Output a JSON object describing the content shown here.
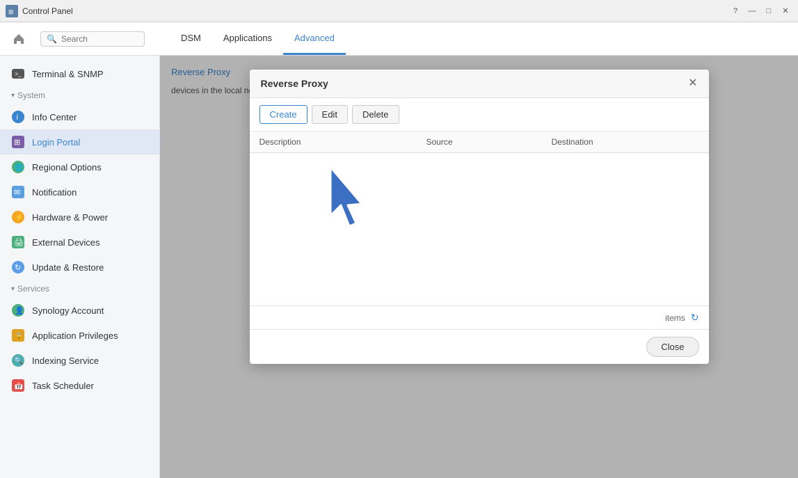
{
  "titlebar": {
    "title": "Control Panel",
    "help_label": "?",
    "minimize_label": "—",
    "maximize_label": "□",
    "close_label": "✕"
  },
  "topnav": {
    "search_placeholder": "Search",
    "tabs": [
      {
        "id": "dsm",
        "label": "DSM",
        "active": false
      },
      {
        "id": "applications",
        "label": "Applications",
        "active": false
      },
      {
        "id": "advanced",
        "label": "Advanced",
        "active": true
      }
    ]
  },
  "sidebar": {
    "terminal_item": {
      "label": "Terminal & SNMP"
    },
    "system_section": "System",
    "items": [
      {
        "id": "info-center",
        "label": "Info Center",
        "active": false
      },
      {
        "id": "login-portal",
        "label": "Login Portal",
        "active": true
      },
      {
        "id": "regional-options",
        "label": "Regional Options",
        "active": false
      },
      {
        "id": "notification",
        "label": "Notification",
        "active": false
      },
      {
        "id": "hardware-power",
        "label": "Hardware & Power",
        "active": false
      },
      {
        "id": "external-devices",
        "label": "External Devices",
        "active": false
      },
      {
        "id": "update-restore",
        "label": "Update & Restore",
        "active": false
      }
    ],
    "services_section": "Services",
    "service_items": [
      {
        "id": "synology-account",
        "label": "Synology Account",
        "active": false
      },
      {
        "id": "application-privileges",
        "label": "Application Privileges",
        "active": false
      },
      {
        "id": "indexing-service",
        "label": "Indexing Service",
        "active": false
      },
      {
        "id": "task-scheduler",
        "label": "Task Scheduler",
        "active": false
      }
    ]
  },
  "content": {
    "description": "devices in the local network."
  },
  "modal": {
    "title": "Reverse Proxy",
    "breadcrumb": "Reverse Proxy",
    "close_label": "✕",
    "create_label": "Create",
    "edit_label": "Edit",
    "delete_label": "Delete",
    "table": {
      "columns": [
        {
          "id": "description",
          "label": "Description"
        },
        {
          "id": "source",
          "label": "Source"
        },
        {
          "id": "destination",
          "label": "Destination"
        }
      ],
      "rows": []
    },
    "footer": {
      "items_label": "items",
      "refresh_icon": "↻"
    },
    "close_button_label": "Close"
  }
}
